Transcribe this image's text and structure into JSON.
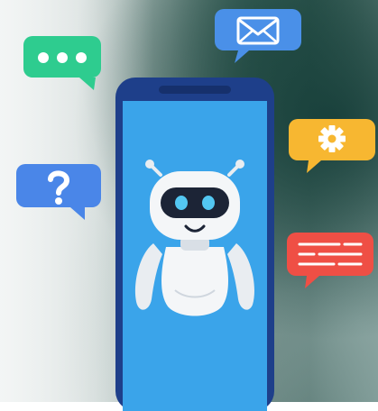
{
  "scene": {
    "subject": "chatbot-on-smartphone",
    "colors": {
      "phone_frame": "#1e3f8a",
      "phone_screen": "#3aa4ea",
      "chat_bubble": "#2ecc8f",
      "mail_bubble": "#4a90e8",
      "gear_bubble": "#f7b731",
      "question_bubble": "#4a86e8",
      "text_bubble": "#ef4f45",
      "robot_body": "#f4f6f8",
      "robot_visor": "#1c2436",
      "robot_eyes": "#53c7f2"
    },
    "icons": [
      "chat-bubble-icon",
      "mail-icon",
      "gear-icon",
      "question-icon",
      "text-lines-icon",
      "robot-icon",
      "smartphone-icon"
    ]
  }
}
